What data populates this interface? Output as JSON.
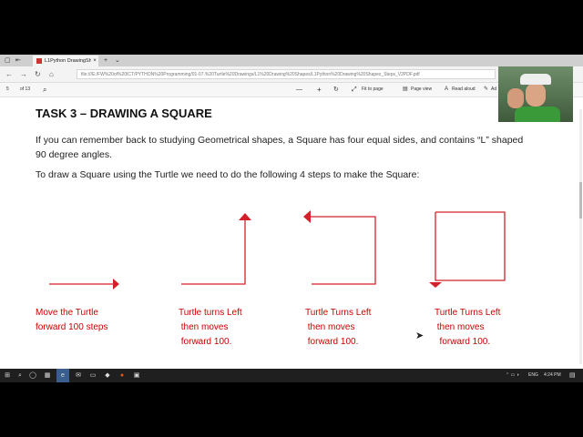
{
  "browser": {
    "tab_title": "L1Python DrawingShap",
    "tab_close": "×",
    "new_tab": "+",
    "tab_list": "⌄",
    "url": "file:///E:/FW%20of%20ICT/PYTHON%20Programming/01-07.%20Turtle%20Drawings/L1%20Drawing%20Shapes/L1Python%20Drawing%20Shapes_Steps_V2PDF.pdf"
  },
  "pdf_toolbar": {
    "page_number": "5",
    "page_total": "of 13",
    "zoom_out": "—",
    "zoom_in": "+",
    "fit_to_page": "Fit to page",
    "page_view": "Page view",
    "read_aloud": "Read aloud",
    "add_notes": "Ad"
  },
  "document": {
    "heading": "TASK 3 – DRAWING A SQUARE",
    "intro": "If you can remember back to studying Geometrical shapes, a Square has four equal sides, and contains “L” shaped 90 degree angles.",
    "steps_intro": "To draw a Square using the Turtle we need to do the following 4 steps to make the Square:",
    "captions": [
      "Move the Turtle\nforward 100 steps",
      "Turtle turns Left\n then moves\n forward 100.",
      "Turtle Turns Left\n then moves\n forward 100.",
      "Turtle Turns Left\n then moves\n  forward 100."
    ]
  },
  "colors": {
    "arrow": "#d4202a",
    "caption": "#cc0000"
  },
  "taskbar": {
    "language": "ENG",
    "time": "4:24 PM"
  }
}
